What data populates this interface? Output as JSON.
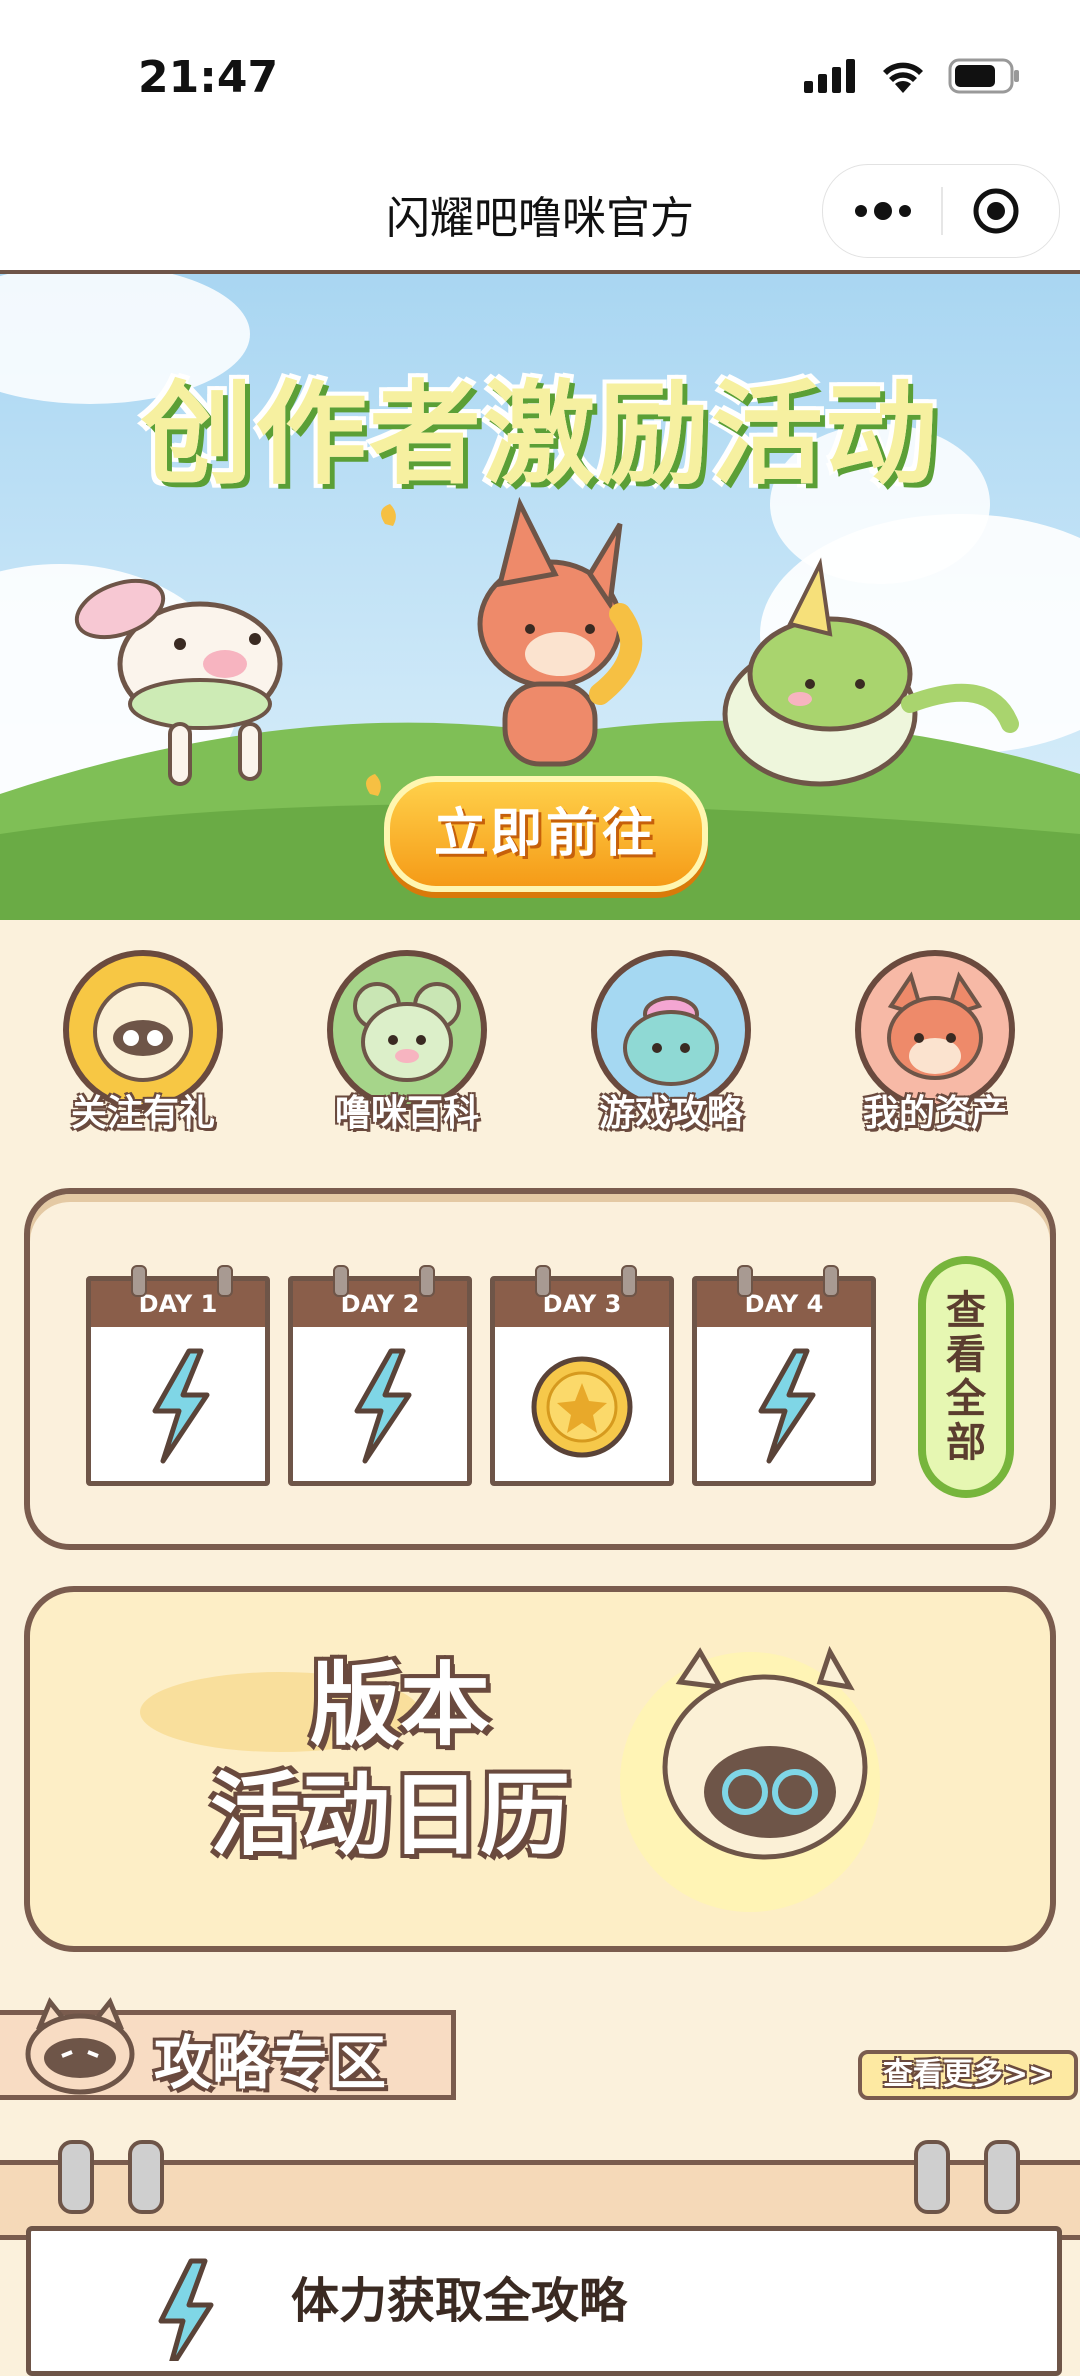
{
  "status_bar": {
    "time": "21:47"
  },
  "nav": {
    "title": "闪耀吧噜咪官方"
  },
  "banner": {
    "title": "创作者激励活动",
    "button_label": "立即前往"
  },
  "menu": [
    {
      "label": "关注有礼",
      "icon": "mascot-raccoon-icon",
      "color": "#f7c744"
    },
    {
      "label": "噜咪百科",
      "icon": "mascot-mouse-icon",
      "color": "#a6d58a"
    },
    {
      "label": "游戏攻略",
      "icon": "mascot-blob-icon",
      "color": "#a5d8f2"
    },
    {
      "label": "我的资产",
      "icon": "mascot-fox-icon",
      "color": "#f7b9a6"
    }
  ],
  "checkin": {
    "days": [
      {
        "label": "DAY 1",
        "reward": "energy-crystal-icon"
      },
      {
        "label": "DAY 2",
        "reward": "energy-crystal-icon"
      },
      {
        "label": "DAY 3",
        "reward": "coin-icon"
      },
      {
        "label": "DAY 4",
        "reward": "energy-crystal-icon"
      }
    ],
    "view_all_label": "查看全部"
  },
  "calendar": {
    "line1": "版本",
    "line2": "活动日历"
  },
  "strategy": {
    "title": "攻略专区",
    "more_label": "查看更多>>"
  },
  "article": {
    "title": "体力获取全攻略"
  }
}
